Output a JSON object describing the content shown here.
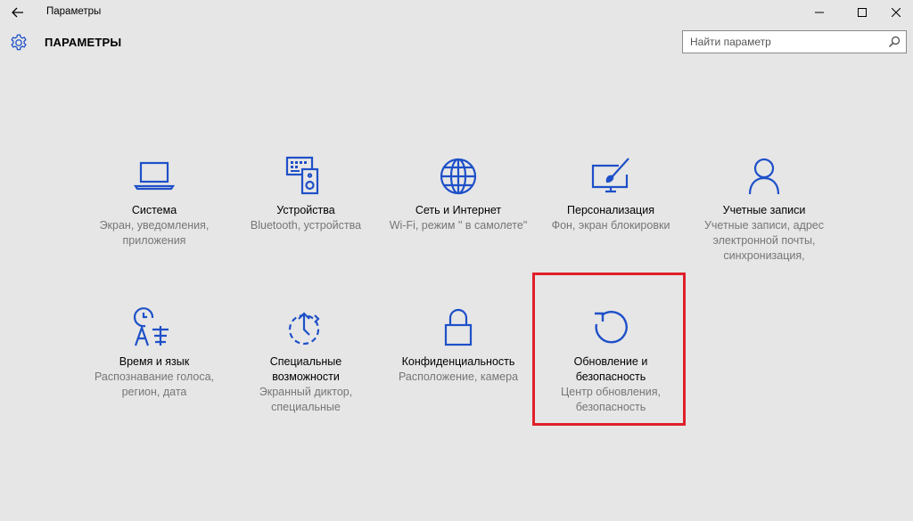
{
  "window": {
    "title": "Параметры",
    "back_icon": "back-arrow-icon",
    "controls": [
      "minimize-icon",
      "maximize-icon",
      "close-icon"
    ]
  },
  "header": {
    "title": "ПАРАМЕТРЫ",
    "icon": "gear-icon",
    "search_placeholder": "Найти параметр"
  },
  "colors": {
    "accent": "#1e50c8",
    "background": "#e6e6e6",
    "highlight": "#e0202a"
  },
  "tiles": [
    {
      "name": "Система",
      "desc": "Экран, уведомления, приложения",
      "icon": "laptop-icon"
    },
    {
      "name": "Устройства",
      "desc": "Bluetooth, устройства",
      "icon": "devices-icon"
    },
    {
      "name": "Сеть и Интернет",
      "desc": "Wi-Fi, режим \" в самолете\"",
      "icon": "globe-icon"
    },
    {
      "name": "Персонализация",
      "desc": "Фон, экран блокировки",
      "icon": "personalization-icon"
    },
    {
      "name": "Учетные записи",
      "desc": "Учетные записи, адрес электронной почты, синхронизация,",
      "icon": "person-icon"
    },
    {
      "name": "Время и язык",
      "desc": "Распознавание голоса, регион, дата",
      "icon": "time-language-icon"
    },
    {
      "name": "Специальные возможности",
      "desc": "Экранный диктор, специальные",
      "icon": "accessibility-icon"
    },
    {
      "name": "Конфиденциальность",
      "desc": "Расположение, камера",
      "icon": "lock-icon"
    },
    {
      "name": "Обновление и безопасность",
      "desc": "Центр обновления, безопасность",
      "icon": "refresh-icon"
    }
  ]
}
